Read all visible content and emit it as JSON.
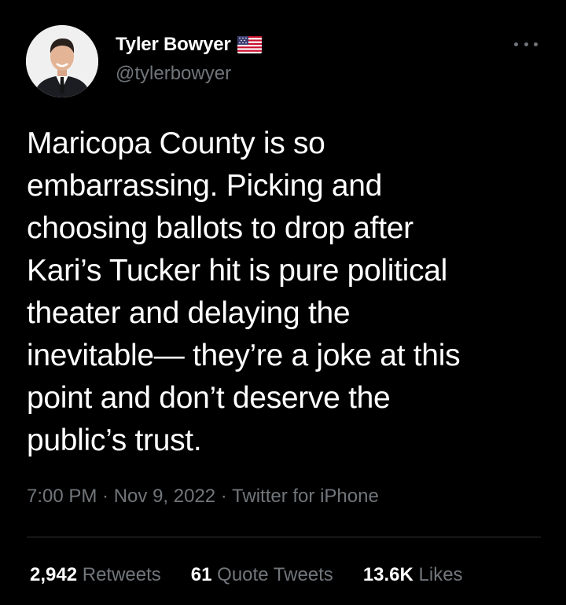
{
  "author": {
    "display_name": "Tyler Bowyer",
    "handle": "@tylerbowyer",
    "flag_icon": "us-flag-icon"
  },
  "tweet": {
    "lines": [
      "Maricopa County is so",
      "embarrassing. Picking and",
      "choosing ballots to drop after",
      "Kari’s Tucker hit is pure political",
      "theater and delaying the",
      "inevitable— they’re a joke at this",
      "point and don’t deserve the",
      "public’s trust."
    ],
    "time": "7:00 PM",
    "date": "Nov 9, 2022",
    "source": "Twitter for iPhone",
    "separator": " · "
  },
  "stats": {
    "retweets": {
      "value": "2,942",
      "label": "Retweets"
    },
    "quote_tweets": {
      "value": "61",
      "label": "Quote Tweets"
    },
    "likes": {
      "value": "13.6K",
      "label": "Likes"
    }
  },
  "colors": {
    "background": "#000000",
    "primary_text": "#ffffff",
    "secondary_text": "#71767b",
    "divider": "#2f3336"
  }
}
